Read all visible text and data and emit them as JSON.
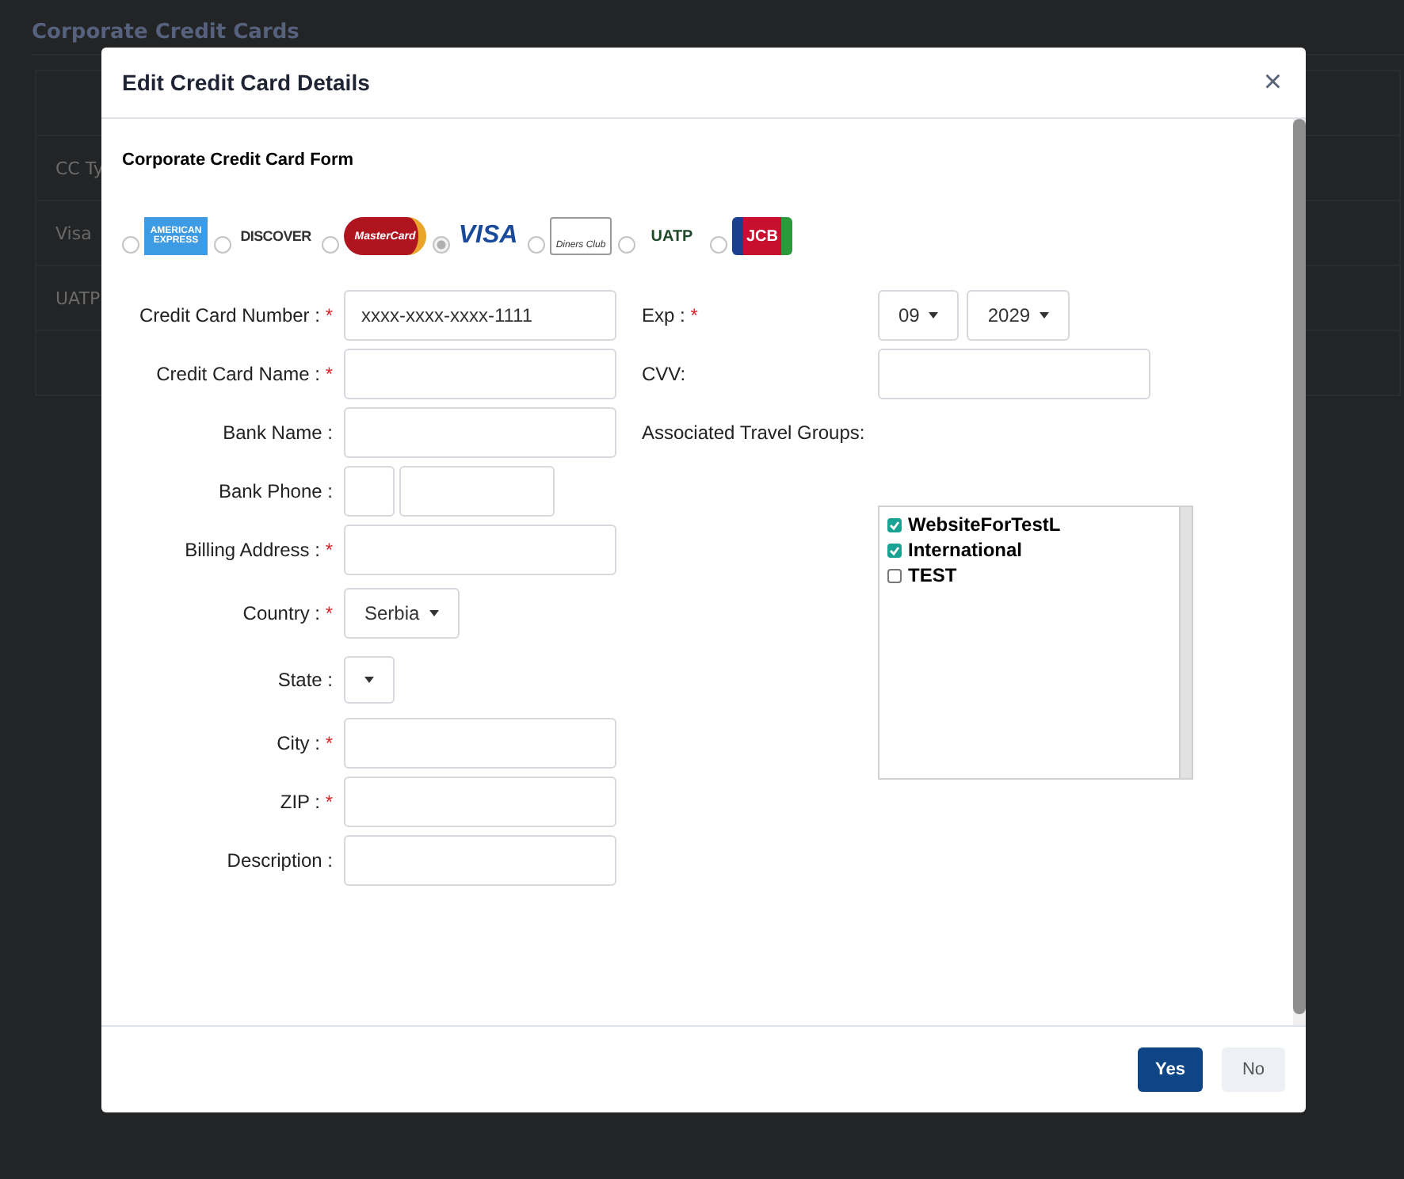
{
  "page": {
    "title": "Corporate Credit Cards",
    "rows": [
      "CC Ty",
      "Visa",
      "UATP"
    ]
  },
  "dialog": {
    "title": "Edit Credit Card Details",
    "close": "×",
    "required_mark": "*",
    "form_title": "Corporate Credit Card Form",
    "card_types": [
      {
        "kind": "amex",
        "label": "AMERICAN EXPRESS",
        "selected": false
      },
      {
        "kind": "discover",
        "label": "DISCOVER",
        "selected": false
      },
      {
        "kind": "mastercard",
        "label": "MasterCard",
        "selected": false
      },
      {
        "kind": "visa",
        "label": "VISA",
        "selected": true
      },
      {
        "kind": "diners",
        "label": "Diners Club",
        "selected": false
      },
      {
        "kind": "uatp",
        "label": "UATP",
        "selected": false
      },
      {
        "kind": "jcb",
        "label": "JCB",
        "selected": false
      }
    ],
    "left_fields": [
      {
        "kind": "text",
        "label": "Credit Card Number :",
        "required": true,
        "value": "xxxx-xxxx-xxxx-1111"
      },
      {
        "kind": "text",
        "label": "Credit Card Name :",
        "required": true
      },
      {
        "kind": "text",
        "label": "Bank Name :",
        "required": false
      },
      {
        "kind": "phone",
        "label": "Bank Phone :",
        "required": false
      },
      {
        "kind": "text",
        "label": "Billing Address :",
        "required": true
      },
      {
        "kind": "dropdown",
        "label": "Country :",
        "required": true,
        "value": "Serbia"
      },
      {
        "kind": "dropdown",
        "label": "State :",
        "required": false
      },
      {
        "kind": "text",
        "label": "City :",
        "required": true
      },
      {
        "kind": "text",
        "label": "ZIP :",
        "required": true
      },
      {
        "kind": "text",
        "label": "Description :",
        "required": false
      }
    ],
    "exp": {
      "label": "Exp :",
      "required": true,
      "month": "09",
      "year": "2029"
    },
    "cvv": {
      "label": "CVV:"
    },
    "travel_groups": {
      "label": "Associated Travel Groups:",
      "items": [
        {
          "name": "WebsiteForTestL",
          "checked": true
        },
        {
          "name": "International",
          "checked": true
        },
        {
          "name": "TEST",
          "checked": false
        }
      ]
    },
    "buttons": [
      {
        "kind": "primary",
        "label": "Yes"
      },
      {
        "kind": "secondary",
        "label": "No"
      }
    ]
  }
}
